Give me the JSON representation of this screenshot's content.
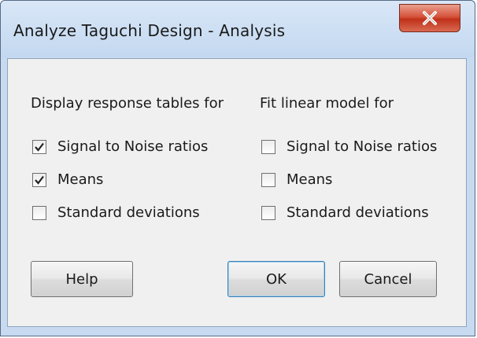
{
  "window": {
    "title": "Analyze Taguchi Design - Analysis",
    "close_glyph": "X"
  },
  "response_tables": {
    "heading": "Display response tables for",
    "options": [
      {
        "label": "Signal to Noise ratios",
        "checked": true
      },
      {
        "label": "Means",
        "checked": true
      },
      {
        "label": "Standard deviations",
        "checked": false
      }
    ]
  },
  "linear_model": {
    "heading": "Fit linear model for",
    "options": [
      {
        "label": "Signal to Noise ratios",
        "checked": false
      },
      {
        "label": "Means",
        "checked": false
      },
      {
        "label": "Standard deviations",
        "checked": false
      }
    ]
  },
  "buttons": {
    "help": "Help",
    "ok": "OK",
    "cancel": "Cancel"
  },
  "colors": {
    "frame": "#c7daf0",
    "close_button": "#c9432b",
    "dialog_body": "#f0f0f0"
  }
}
